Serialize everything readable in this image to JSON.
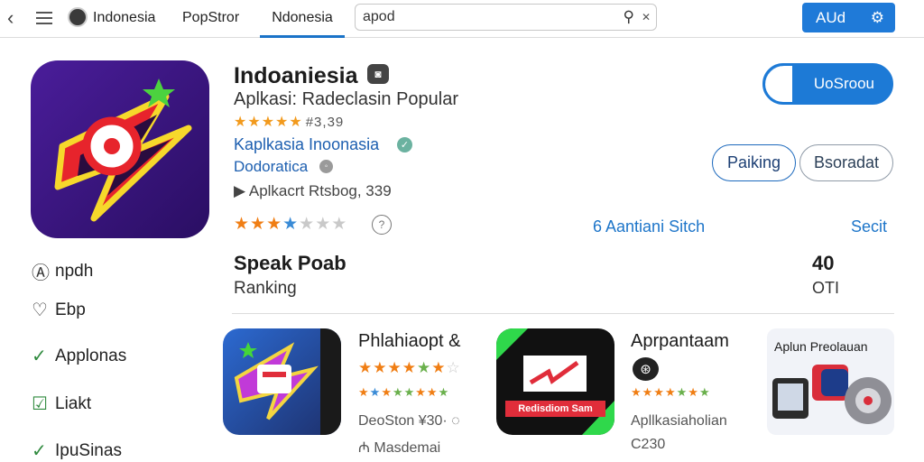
{
  "topbar": {
    "back_glyph": "‹",
    "tab_country": "Indonesia",
    "tab_store": "PopStror",
    "tab_active": "Ndonesia",
    "search_value": "apod",
    "action_label": "AUd"
  },
  "app": {
    "title": "Indoaniesia",
    "subtitle": "Aplkasi: Radeclasin Popular",
    "rating_value": "#3,39",
    "developer": "Kaplkasia Inoonasia",
    "developer2": "Dodoratica",
    "info": "Aplkacrt  Rtsbog, 339",
    "primary_button": "UoSroou",
    "pill_a": "Paiking",
    "pill_b": "Bsoradat",
    "link_a": "6 Aantiani Sitch",
    "link_b": "Secit"
  },
  "section": {
    "title": "Speak Poab",
    "subtitle": "Ranking",
    "number": "40",
    "unit": "OTI"
  },
  "sidebar": {
    "items": [
      {
        "label": "npdh",
        "icon": "person-icon"
      },
      {
        "label": "Ebp",
        "icon": "heart-icon"
      },
      {
        "label": "Applonas",
        "icon": "check-icon"
      },
      {
        "label": "Liakt",
        "icon": "edit-icon"
      },
      {
        "label": "IpuSinas",
        "icon": "check-icon"
      }
    ]
  },
  "cards": [
    {
      "title": "Phlahiaopt &",
      "line1": "DeoSton  ¥30· ◌",
      "line2": "₼ Masdemai"
    },
    {
      "title": "Aprpantaam",
      "line1": "Apllkasiaholian",
      "line2": "C230",
      "banner": "Redisdiom Sam"
    },
    {
      "title": "Aplun Preolauan"
    }
  ],
  "colors": {
    "accent": "#1f7ad8",
    "star": "#f07e14",
    "link": "#1d75c9"
  }
}
